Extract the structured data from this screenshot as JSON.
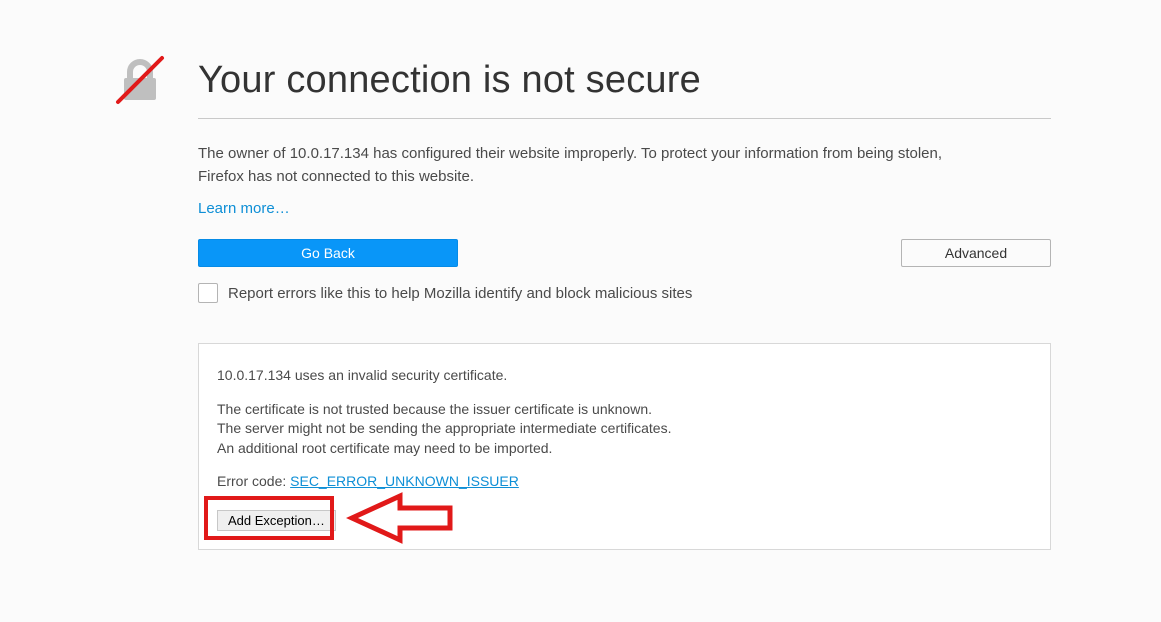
{
  "header": {
    "title": "Your connection is not secure"
  },
  "main": {
    "description": "The owner of 10.0.17.134 has configured their website improperly. To protect your information from being stolen, Firefox has not connected to this website.",
    "learn_more": "Learn more…",
    "go_back": "Go Back",
    "advanced": "Advanced",
    "report_label": "Report errors like this to help Mozilla identify and block malicious sites"
  },
  "details": {
    "line1": "10.0.17.134 uses an invalid security certificate.",
    "line2": "The certificate is not trusted because the issuer certificate is unknown.",
    "line3": "The server might not be sending the appropriate intermediate certificates.",
    "line4": "An additional root certificate may need to be imported.",
    "error_prefix": "Error code: ",
    "error_code": "SEC_ERROR_UNKNOWN_ISSUER",
    "add_exception": "Add Exception…"
  }
}
